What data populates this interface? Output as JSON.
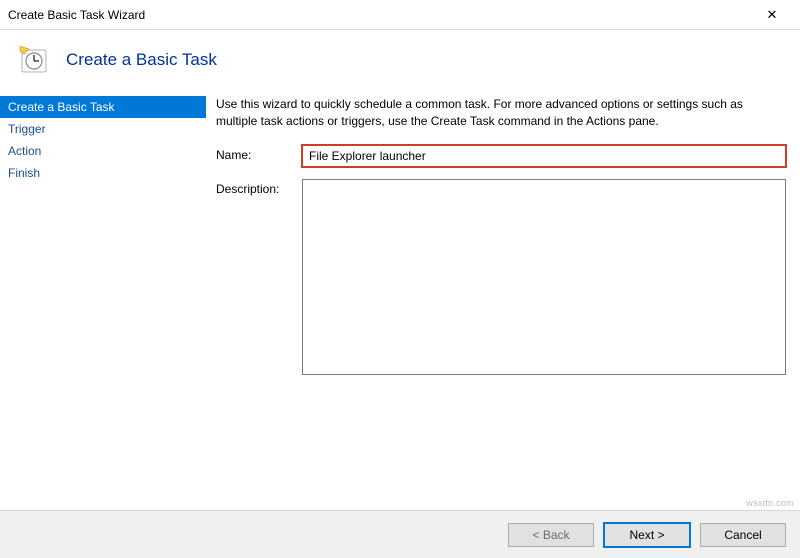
{
  "window": {
    "title": "Create Basic Task Wizard"
  },
  "header": {
    "title": "Create a Basic Task"
  },
  "sidebar": {
    "items": [
      {
        "label": "Create a Basic Task",
        "active": true
      },
      {
        "label": "Trigger",
        "active": false
      },
      {
        "label": "Action",
        "active": false
      },
      {
        "label": "Finish",
        "active": false
      }
    ]
  },
  "main": {
    "intro": "Use this wizard to quickly schedule a common task.  For more advanced options or settings such as multiple task actions or triggers, use the Create Task command in the Actions pane.",
    "name_label": "Name:",
    "name_value": "File Explorer launcher",
    "description_label": "Description:",
    "description_value": ""
  },
  "footer": {
    "back_label": "< Back",
    "next_label": "Next >",
    "cancel_label": "Cancel"
  },
  "watermark": "wsxdn.com"
}
